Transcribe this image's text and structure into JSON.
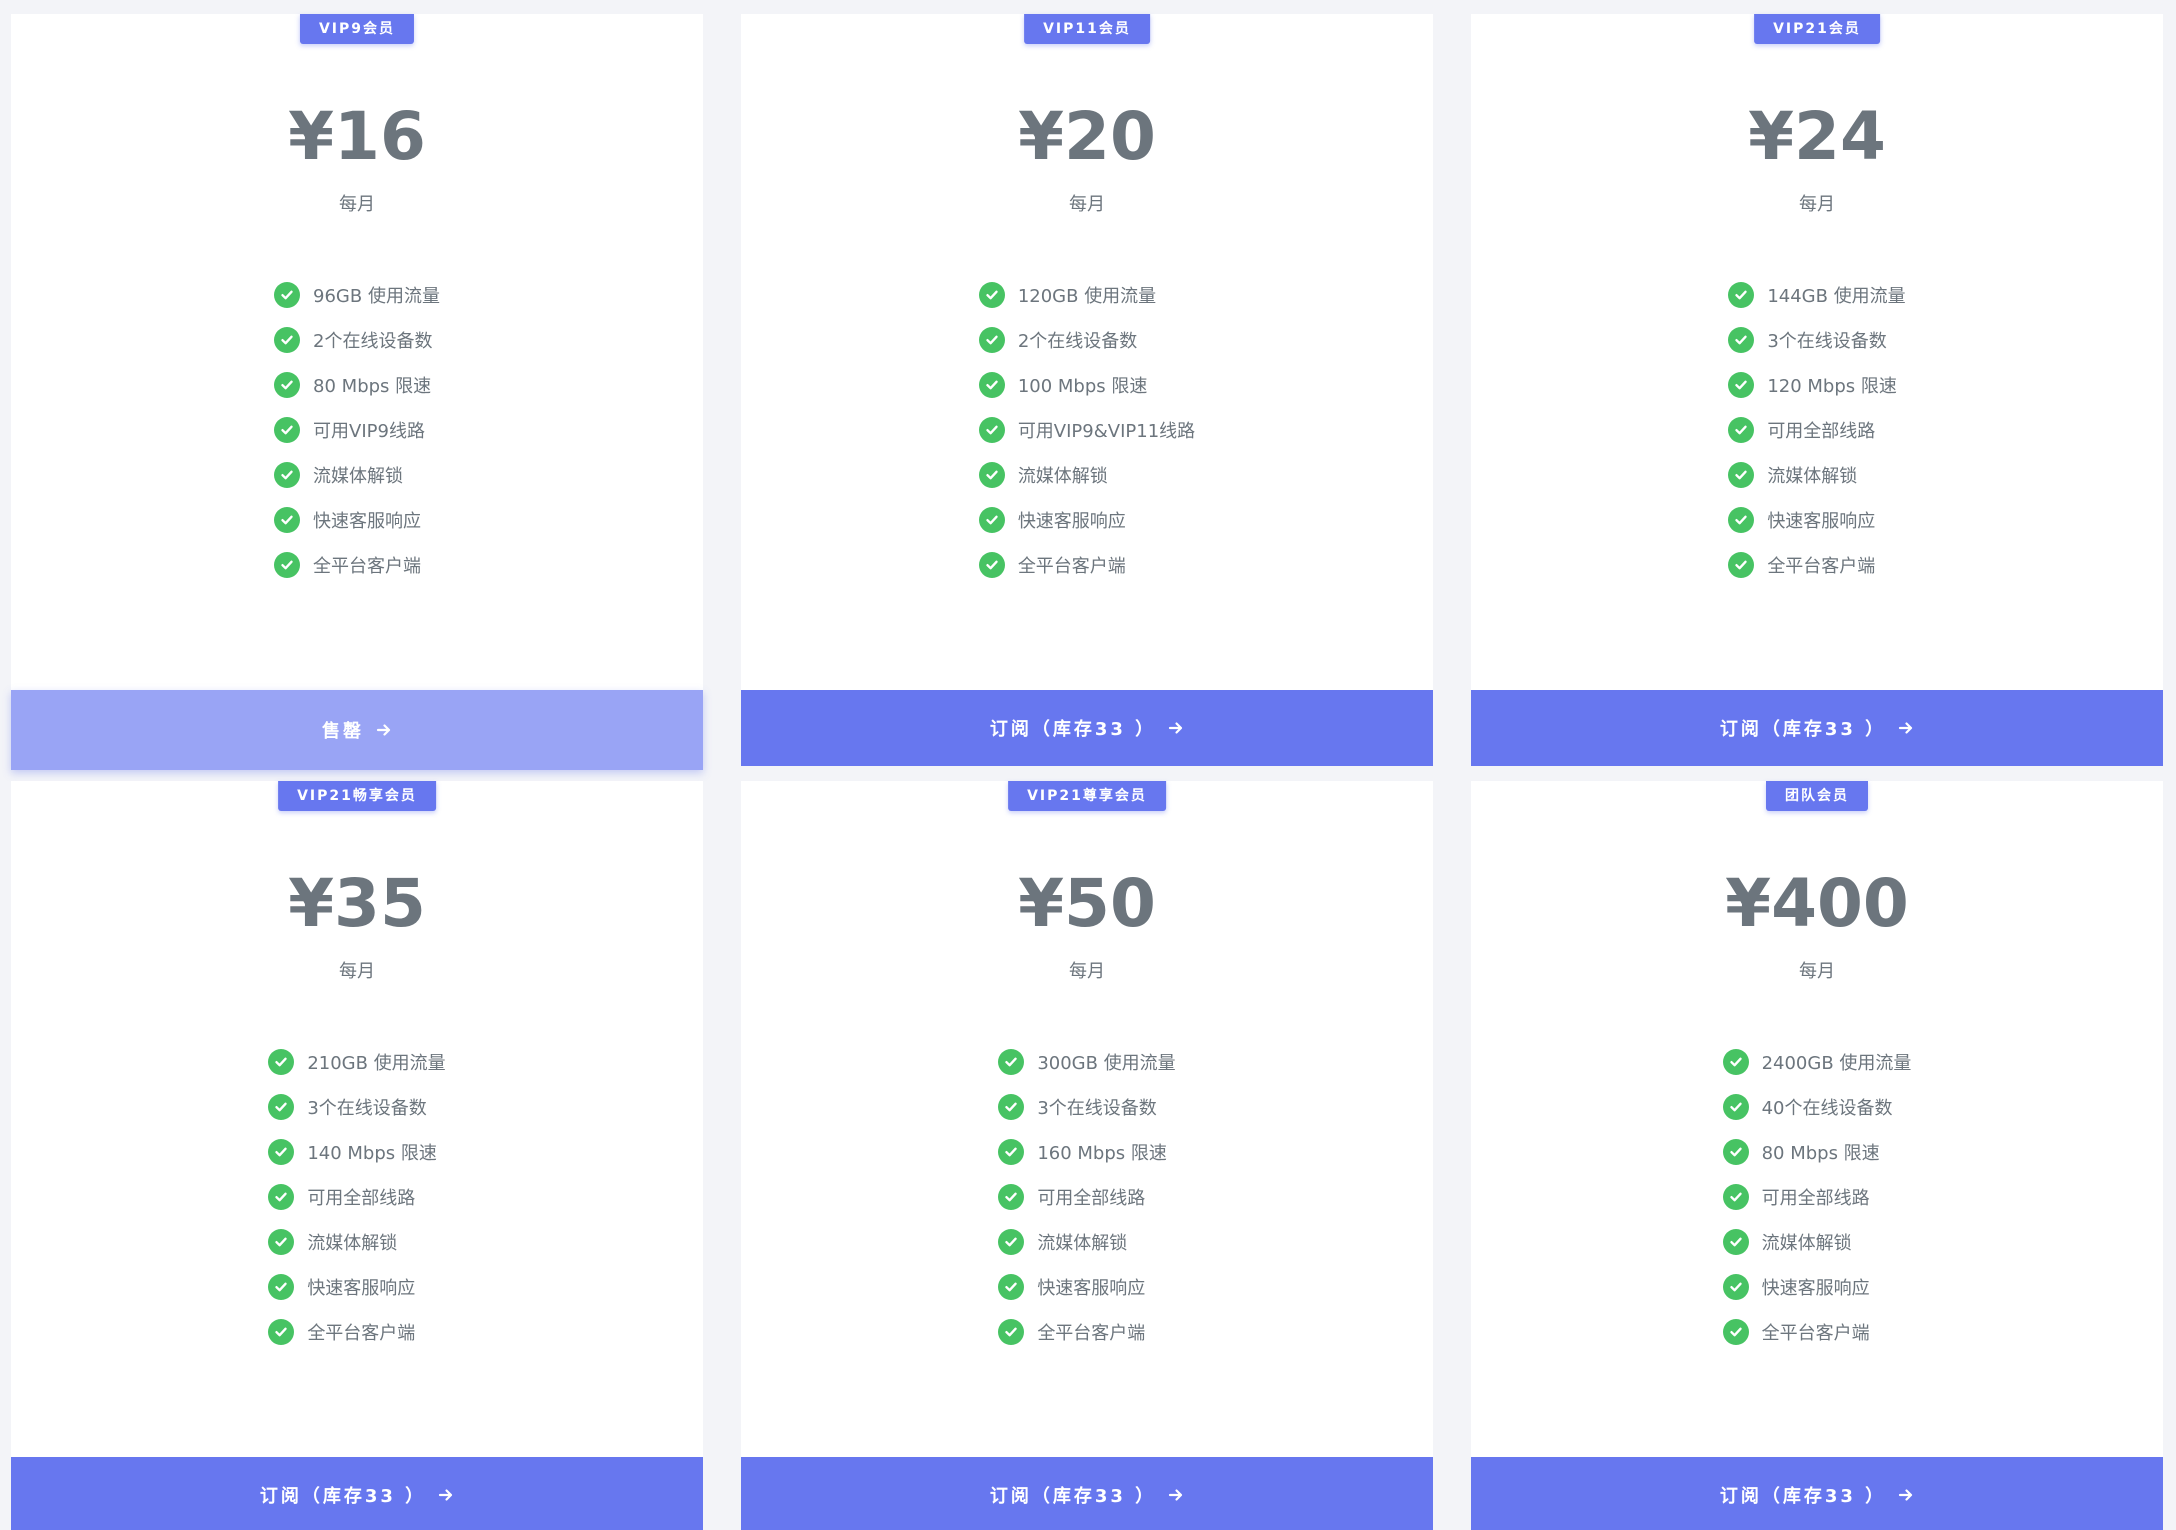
{
  "plans": [
    {
      "badge": "VIP9会员",
      "price": "¥16",
      "period": "每月",
      "features": [
        "96GB 使用流量",
        "2个在线设备数",
        "80 Mbps 限速",
        "可用VIP9线路",
        "流媒体解锁",
        "快速客服响应",
        "全平台客户端"
      ],
      "button_label": "售罄",
      "sold_out": true
    },
    {
      "badge": "VIP11会员",
      "price": "¥20",
      "period": "每月",
      "features": [
        "120GB 使用流量",
        "2个在线设备数",
        "100 Mbps 限速",
        "可用VIP9&VIP11线路",
        "流媒体解锁",
        "快速客服响应",
        "全平台客户端"
      ],
      "button_label": "订阅（库存33 ）",
      "sold_out": false
    },
    {
      "badge": "VIP21会员",
      "price": "¥24",
      "period": "每月",
      "features": [
        "144GB 使用流量",
        "3个在线设备数",
        "120 Mbps 限速",
        "可用全部线路",
        "流媒体解锁",
        "快速客服响应",
        "全平台客户端"
      ],
      "button_label": "订阅（库存33 ）",
      "sold_out": false
    },
    {
      "badge": "VIP21畅享会员",
      "price": "¥35",
      "period": "每月",
      "features": [
        "210GB 使用流量",
        "3个在线设备数",
        "140 Mbps 限速",
        "可用全部线路",
        "流媒体解锁",
        "快速客服响应",
        "全平台客户端"
      ],
      "button_label": "订阅（库存33 ）",
      "sold_out": false
    },
    {
      "badge": "VIP21尊享会员",
      "price": "¥50",
      "period": "每月",
      "features": [
        "300GB 使用流量",
        "3个在线设备数",
        "160 Mbps 限速",
        "可用全部线路",
        "流媒体解锁",
        "快速客服响应",
        "全平台客户端"
      ],
      "button_label": "订阅（库存33 ）",
      "sold_out": false
    },
    {
      "badge": "团队会员",
      "price": "¥400",
      "period": "每月",
      "features": [
        "2400GB 使用流量",
        "40个在线设备数",
        "80 Mbps 限速",
        "可用全部线路",
        "流媒体解锁",
        "快速客服响应",
        "全平台客户端"
      ],
      "button_label": "订阅（库存33 ）",
      "sold_out": false
    }
  ],
  "icons": {
    "feature": "check-circle-icon",
    "button": "arrow-right-icon"
  },
  "colors": {
    "accent": "#6777ef",
    "accent_disabled": "#99a4f5",
    "check": "#47c363",
    "text_muted": "#6c757d",
    "background": "#f3f4f8"
  }
}
